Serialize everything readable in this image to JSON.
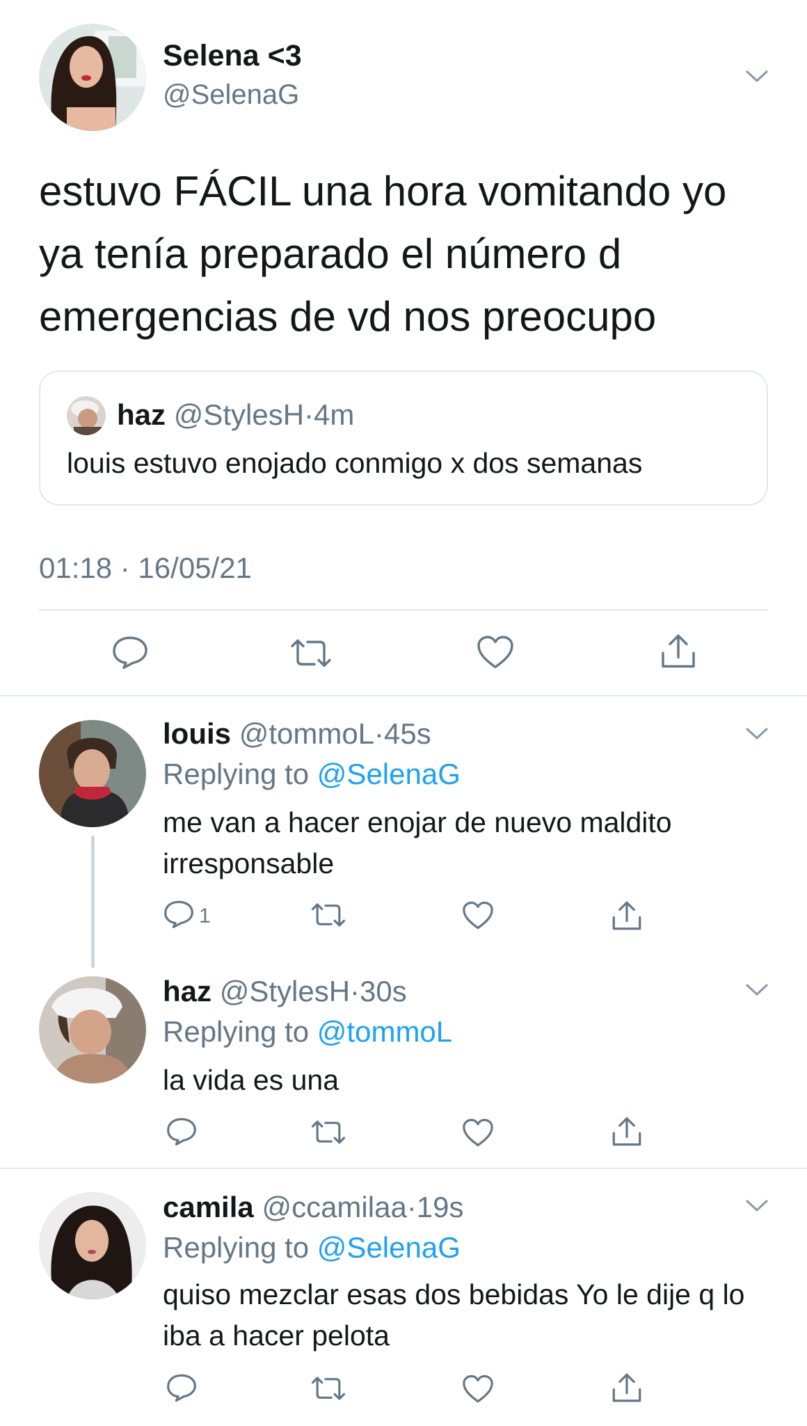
{
  "main_tweet": {
    "name": "Selena <3",
    "handle": "@SelenaG",
    "text": "estuvo FÁCIL una hora vomitando yo ya tenía preparado el número d emergencias de vd nos preocupo",
    "quote": {
      "name": "haz",
      "handle": "@StylesH",
      "dot": "·",
      "time": "4m",
      "text": "louis estuvo enojado conmigo x dos semanas"
    },
    "timestamp": "01:18 · 16/05/21"
  },
  "replies": [
    {
      "name": "louis",
      "handle": "@tommoL",
      "dot": "·",
      "time": "45s",
      "replying_prefix": "Replying to",
      "replying_to": "@SelenaG",
      "text": "me van a hacer enojar de nuevo maldito irresponsable",
      "reply_count": "1"
    },
    {
      "name": "haz",
      "handle": "@StylesH",
      "dot": "·",
      "time": "30s",
      "replying_prefix": "Replying to",
      "replying_to": "@tommoL",
      "text": "la vida es una"
    },
    {
      "name": "camila",
      "handle": "@ccamilaa",
      "dot": "·",
      "time": "19s",
      "replying_prefix": "Replying to",
      "replying_to": "@SelenaG",
      "text": "quiso mezclar esas dos bebidas Yo le dije q lo iba a hacer pelota"
    }
  ],
  "colors": {
    "text_primary": "#14171a",
    "text_secondary": "#657786",
    "link": "#1da1f2",
    "divider": "#e1e8ed"
  },
  "icons": [
    "reply-icon",
    "retweet-icon",
    "like-icon",
    "share-icon",
    "chevron-down-icon"
  ]
}
